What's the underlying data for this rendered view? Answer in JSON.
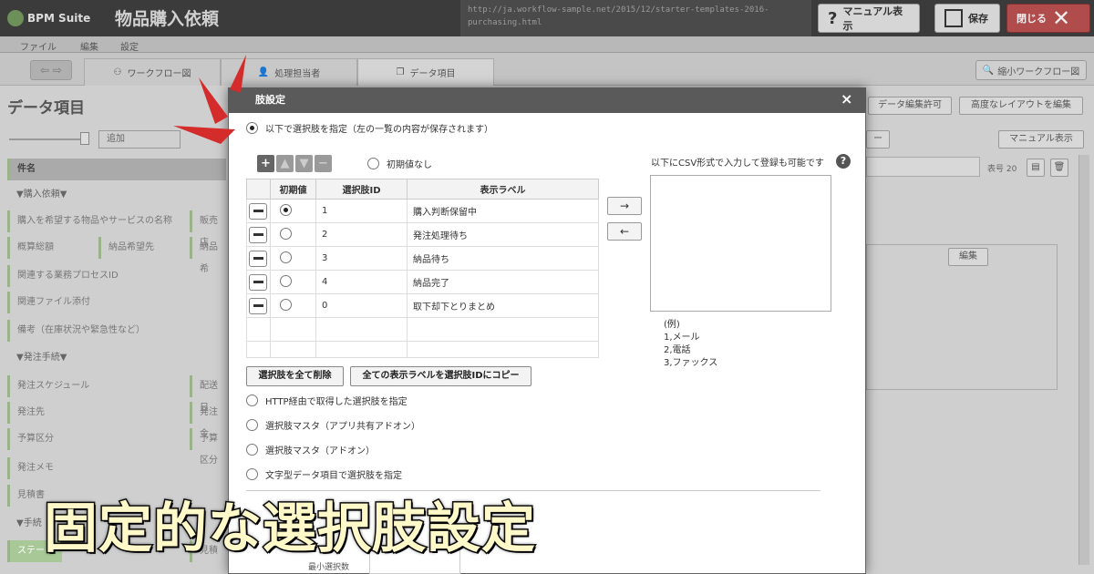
{
  "header": {
    "logo_text": "BPM Suite",
    "app_title": "物品購入依頼",
    "url_line1": "http://ja.workflow-sample.net/2015/12/starter-templates-2016-",
    "url_line2": "purchasing.html",
    "manual_label": "マニュアル表示",
    "save_label": "保存",
    "close_label": "閉じる"
  },
  "menu": [
    "ファイル",
    "編集",
    "設定"
  ],
  "tabs": [
    {
      "label": "ワークフロー図"
    },
    {
      "label": "処理担当者"
    },
    {
      "label": "データ項目"
    }
  ],
  "mini_workflow_label": "縮小ワークフロー図",
  "panel": {
    "title": "データ項目",
    "add_label": "追加",
    "rows": [
      {
        "label": "件名"
      },
      {
        "label": "▼購入依頼▼"
      },
      {
        "label": "購入を希望する物品やサービスの名称"
      },
      {
        "label": "概算総額"
      },
      {
        "label": "納品希望先"
      },
      {
        "label": "関連する業務プロセスID"
      },
      {
        "label": "関連ファイル添付"
      },
      {
        "label": "備考（在庫状況や緊急性など）"
      },
      {
        "label": "▼発注手続▼"
      },
      {
        "label": "発注スケジュール"
      },
      {
        "label": "発注先"
      },
      {
        "label": "予算区分"
      },
      {
        "label": "発注メモ"
      },
      {
        "label": "見積書"
      },
      {
        "label": "▼手続"
      },
      {
        "label": "ステー"
      }
    ],
    "side_fragments": [
      "販売店",
      "納品希",
      "配送日",
      "発注金",
      "予算区分",
      "見積"
    ]
  },
  "right_bg": {
    "edit_permission": "データ編集許可",
    "advanced_layout": "高度なレイアウトを編集",
    "manual_label": "マニュアル表示",
    "seq_label": "表号 20",
    "edit_label": "編集"
  },
  "modal": {
    "title": "肢設定",
    "close": "×",
    "opt_specify": "以下で選択肢を指定（左の一覧の内容が保存されます）",
    "no_default": "初期値なし",
    "csv_hint": "以下にCSV形式で入力して登録も可能です",
    "columns": [
      "初期値",
      "選択肢ID",
      "表示ラベル"
    ],
    "options": [
      {
        "id": "1",
        "label": "購入判断保留中",
        "selected": true
      },
      {
        "id": "2",
        "label": "発注処理待ち",
        "selected": false
      },
      {
        "id": "3",
        "label": "納品待ち",
        "selected": false
      },
      {
        "id": "4",
        "label": "納品完了",
        "selected": false
      },
      {
        "id": "0",
        "label": "取下却下とりまとめ",
        "selected": false
      }
    ],
    "arrow_right": "→",
    "arrow_left": "←",
    "example": [
      "(例)",
      "1,メール",
      "2,電話",
      "3,ファックス"
    ],
    "delete_all": "選択肢を全て削除",
    "copy_all": "全ての表示ラベルを選択肢IDにコピー",
    "opt_http": "HTTP経由で取得した選択肢を指定",
    "opt_master_shared": "選択肢マスタ（アプリ共有アドオン）",
    "opt_master": "選択肢マスタ（アドオン）",
    "opt_string": "文字型データ項目で選択肢を指定",
    "min_select": "最小選択数"
  },
  "caption": "固定的な選択肢設定",
  "colors": {
    "attention": "#d42b2b",
    "caption_fill": "#fff8c8"
  }
}
